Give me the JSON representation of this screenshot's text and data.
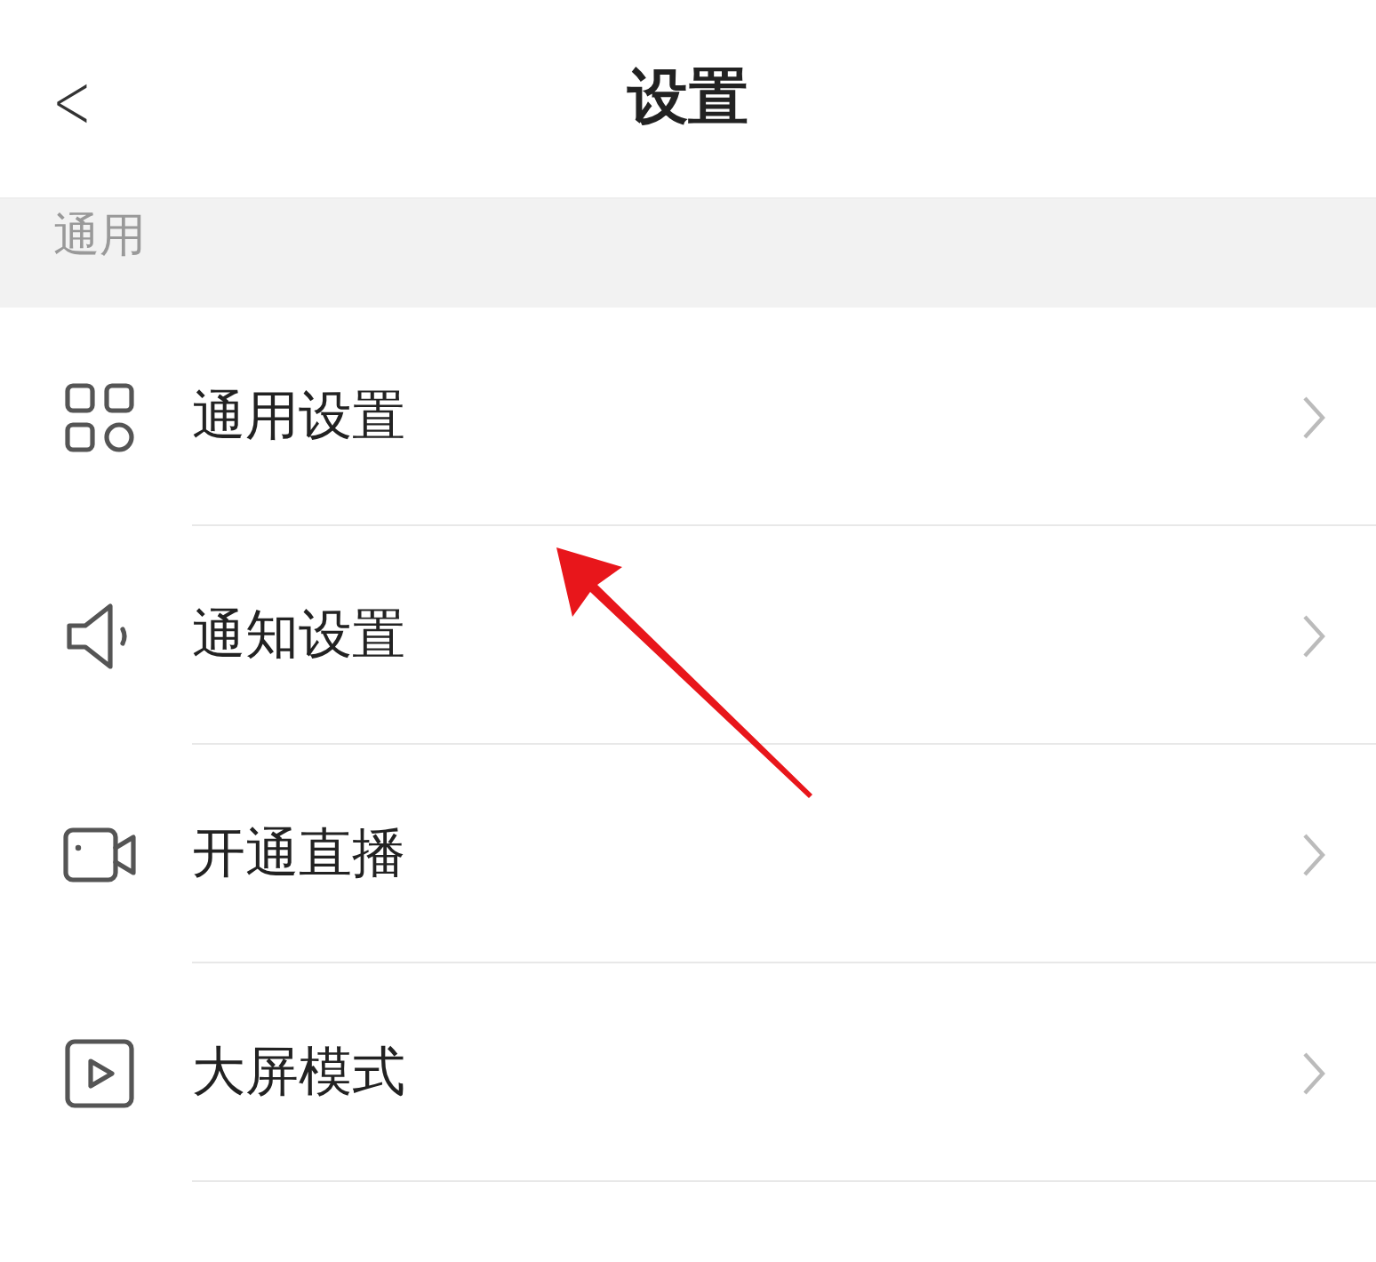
{
  "header": {
    "back": "<",
    "title": "设置"
  },
  "section": {
    "label": "通用"
  },
  "items": [
    {
      "kind": "grid",
      "label": "通用设置"
    },
    {
      "kind": "speaker",
      "label": "通知设置"
    },
    {
      "kind": "camera",
      "label": "开通直播"
    },
    {
      "kind": "play",
      "label": "大屏模式"
    }
  ]
}
